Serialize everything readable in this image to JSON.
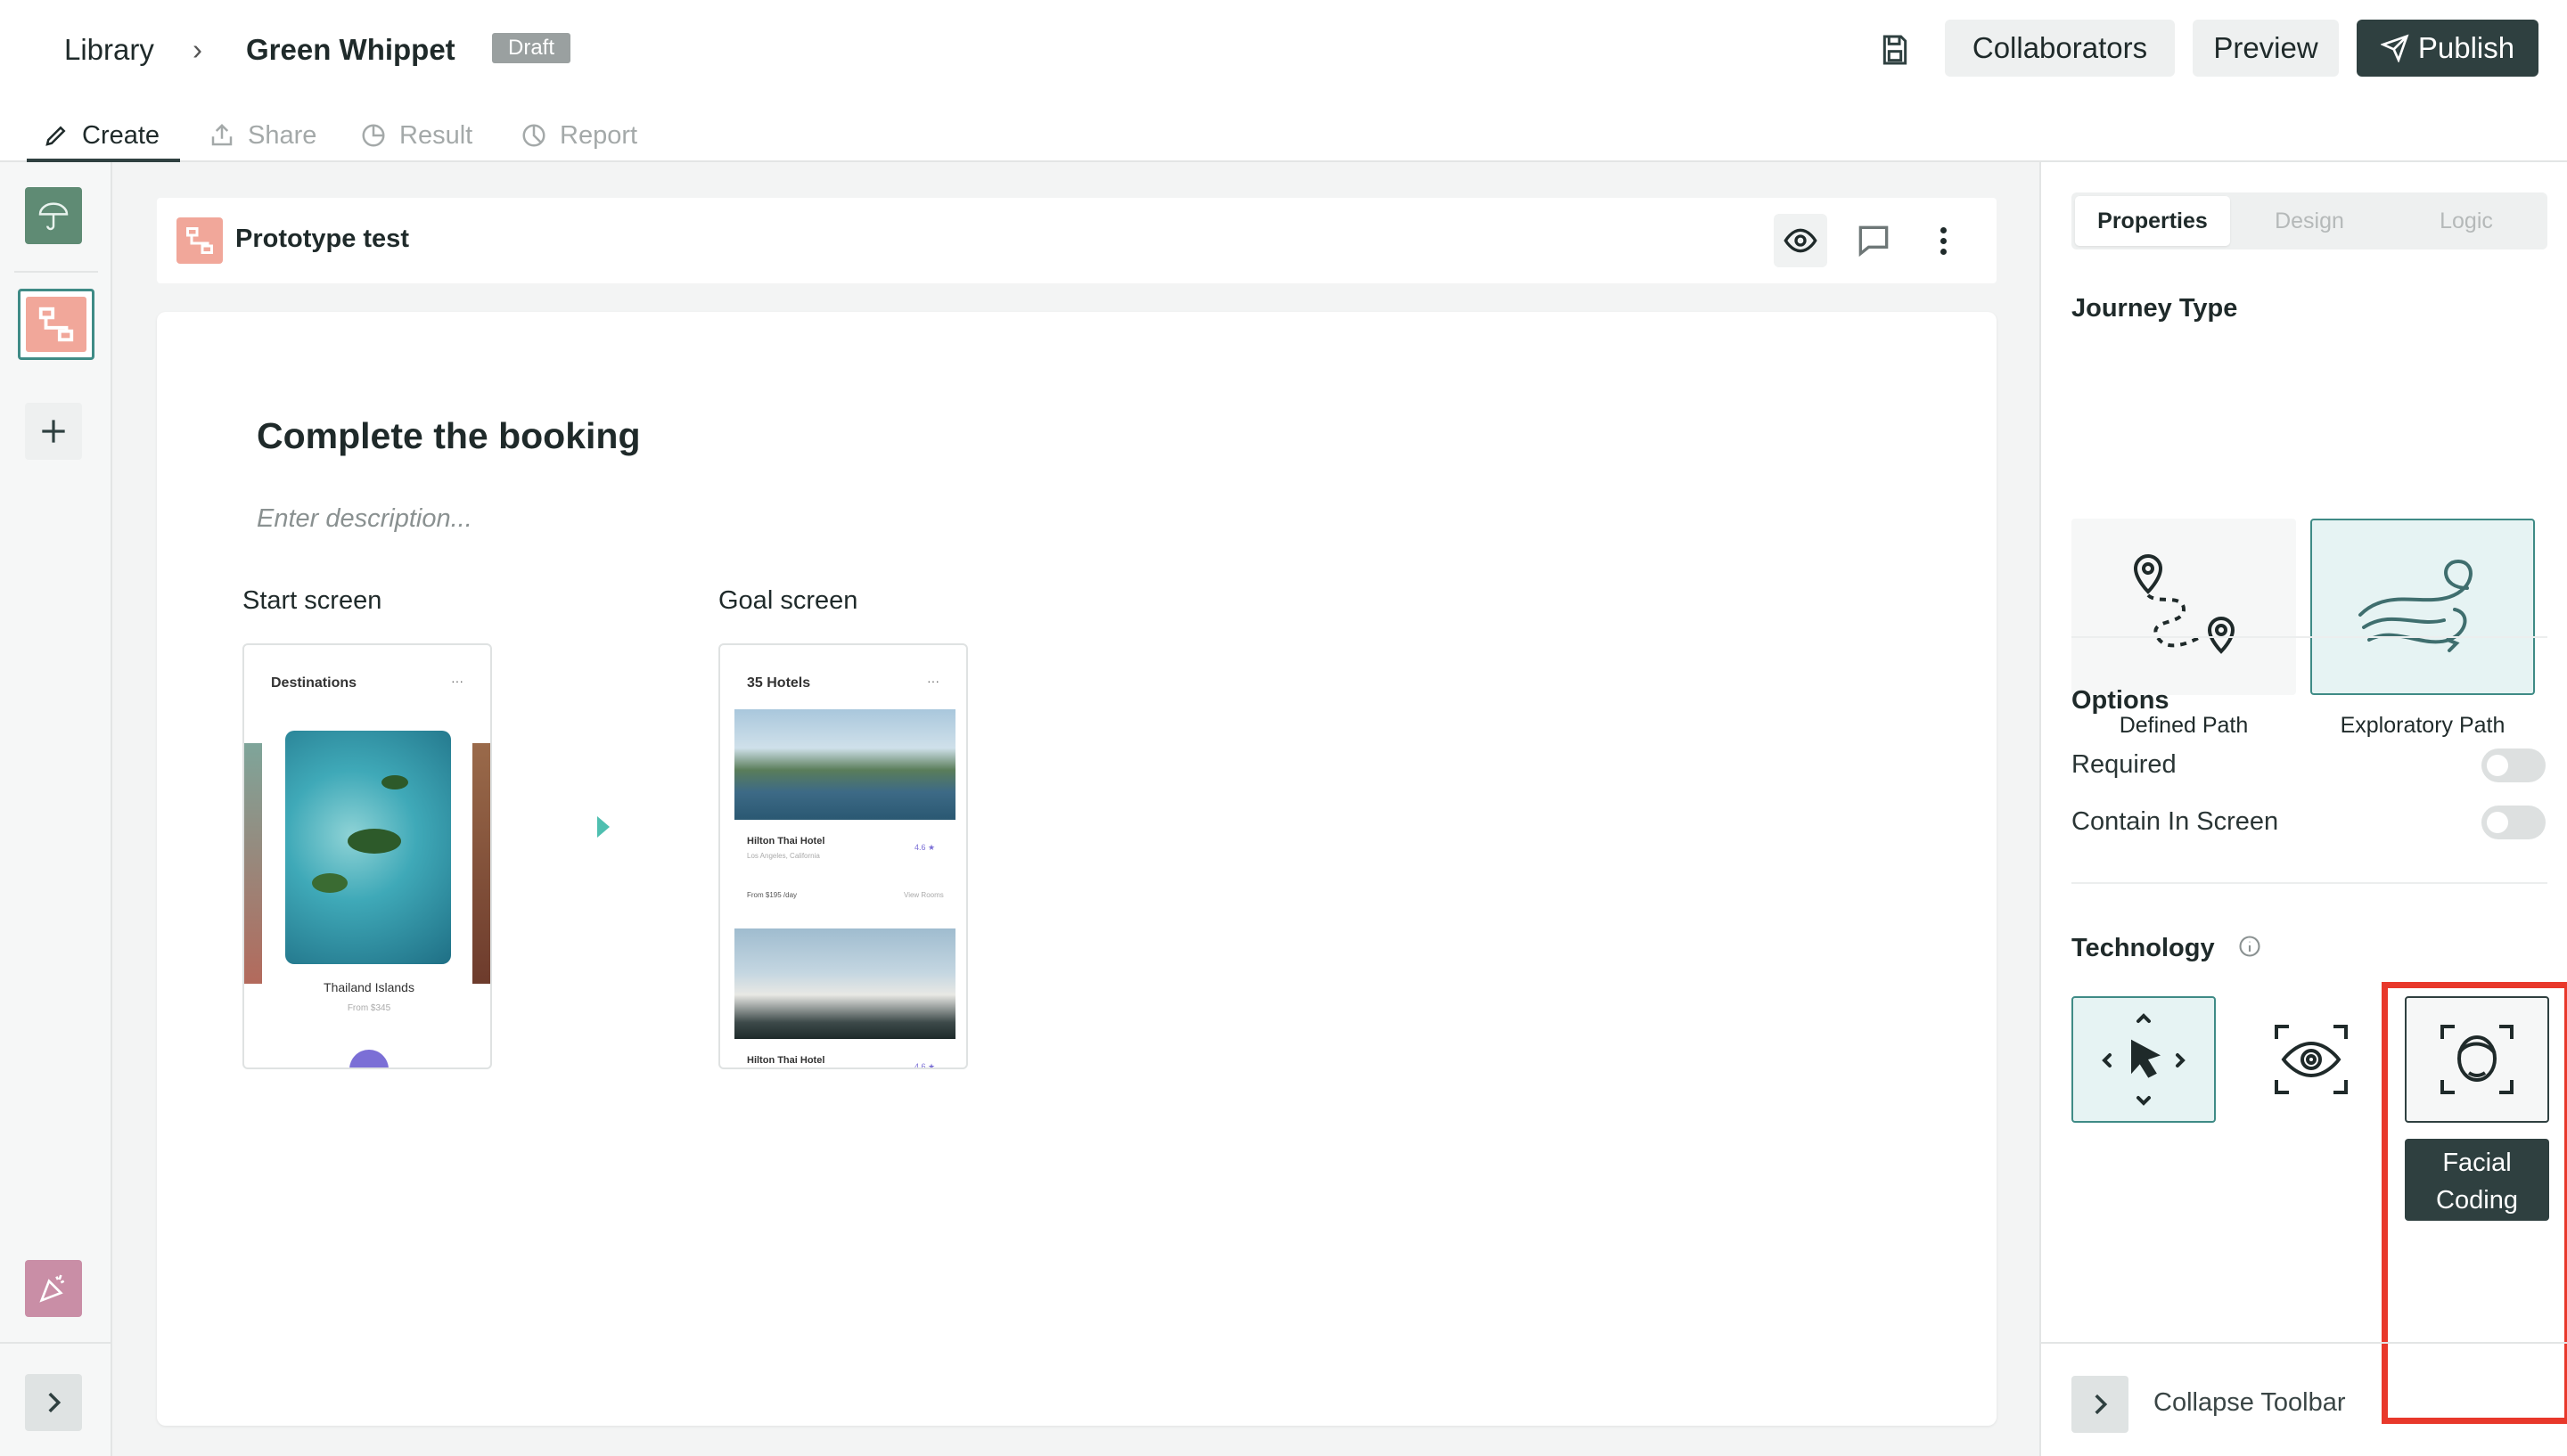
{
  "breadcrumb": {
    "root": "Library",
    "separator": "›",
    "project": "Green Whippet",
    "status": "Draft"
  },
  "header_actions": {
    "collaborators": "Collaborators",
    "preview": "Preview",
    "publish": "Publish"
  },
  "tabs": [
    "Create",
    "Share",
    "Result",
    "Report"
  ],
  "block": {
    "title": "Prototype test"
  },
  "task": {
    "title": "Complete the booking",
    "description_placeholder": "Enter description...",
    "start_label": "Start screen",
    "goal_label": "Goal screen",
    "start_screen": {
      "header": "Destinations",
      "menu": "···",
      "caption": "Thailand Islands",
      "sub": "From $345"
    },
    "goal_screen": {
      "header": "35 Hotels",
      "menu": "···",
      "hotel1": "Hilton Thai Hotel",
      "hotel1_loc": "Los Angeles, California",
      "hotel1_rating": "4.6 ★",
      "hotel1_price": "From $195 /day",
      "hotel1_link": "View Rooms",
      "hotel2": "Hilton Thai Hotel",
      "hotel2_rating": "4.6 ★"
    }
  },
  "panel": {
    "tabs": [
      "Properties",
      "Design",
      "Logic"
    ],
    "journey_title": "Journey Type",
    "journey_options": [
      "Defined Path",
      "Exploratory Path"
    ],
    "options_title": "Options",
    "options": [
      "Required",
      "Contain In Screen"
    ],
    "technology_title": "Technology",
    "tooltip_line1": "Facial",
    "tooltip_line2": "Coding",
    "collapse_label": "Collapse Toolbar"
  },
  "colors": {
    "accent_dark": "#2f4040",
    "selected_bg": "#e6f3f3",
    "highlight_red": "#e8382b",
    "block_icon": "#f1a79a"
  }
}
